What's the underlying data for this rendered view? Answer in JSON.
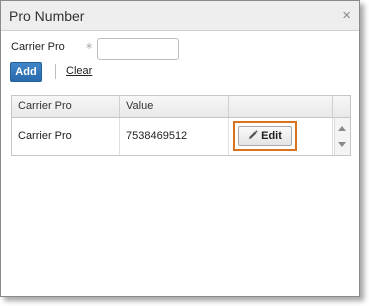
{
  "dialog": {
    "title": "Pro Number",
    "close_glyph": "×"
  },
  "form": {
    "label": "Carrier Pro",
    "required_glyph": "∗",
    "input_value": "",
    "input_placeholder": "",
    "add_label": "Add",
    "clear_label": "Clear"
  },
  "grid": {
    "columns": [
      "Carrier Pro",
      "Value",
      ""
    ],
    "rows": [
      {
        "carrier_pro": "Carrier Pro",
        "value": "7538469512",
        "action_label": "Edit"
      }
    ]
  },
  "colors": {
    "accent": "#2f74b8",
    "highlight": "#d9731f"
  },
  "icons": {
    "close": "close-icon",
    "edit": "pencil-icon",
    "scroll_up": "chevron-up-icon",
    "scroll_down": "chevron-down-icon"
  }
}
